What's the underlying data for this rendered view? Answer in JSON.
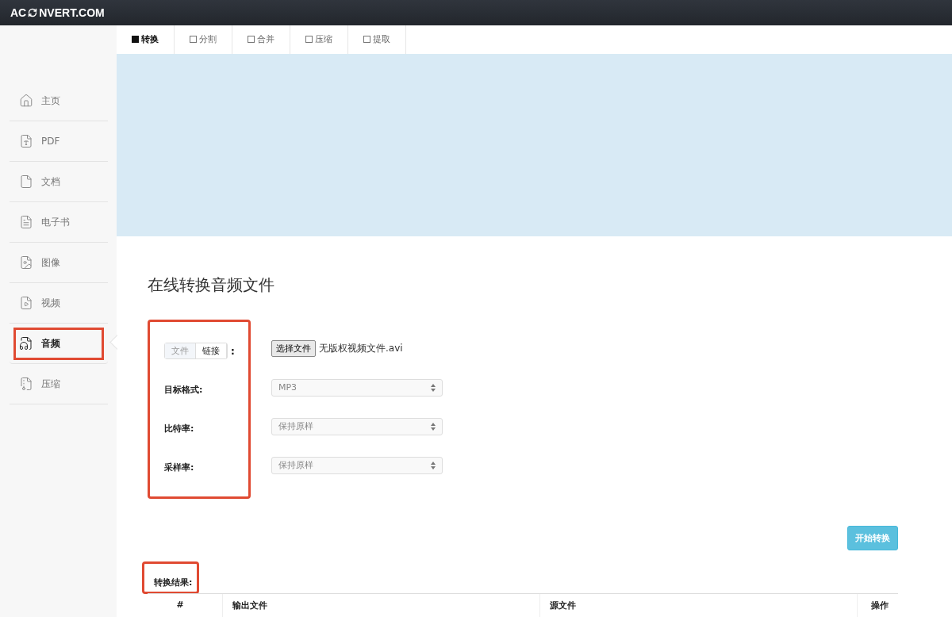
{
  "logo": {
    "before": "AC",
    "after": "NVERT.COM"
  },
  "sidebar": {
    "items": [
      {
        "label": "主页",
        "kind": "home",
        "selected": false,
        "annotated": false
      },
      {
        "label": "PDF",
        "kind": "pdf",
        "selected": false,
        "annotated": false
      },
      {
        "label": "文档",
        "kind": "word",
        "selected": false,
        "annotated": false
      },
      {
        "label": "电子书",
        "kind": "text",
        "selected": false,
        "annotated": false
      },
      {
        "label": "图像",
        "kind": "image",
        "selected": false,
        "annotated": false
      },
      {
        "label": "视频",
        "kind": "video",
        "selected": false,
        "annotated": false
      },
      {
        "label": "音频",
        "kind": "audio",
        "selected": true,
        "annotated": true
      },
      {
        "label": "压缩",
        "kind": "archive",
        "selected": false,
        "annotated": false
      }
    ]
  },
  "tabs": [
    {
      "label": "转换",
      "selected": true
    },
    {
      "label": "分割",
      "selected": false
    },
    {
      "label": "合并",
      "selected": false
    },
    {
      "label": "压缩",
      "selected": false
    },
    {
      "label": "提取",
      "selected": false
    }
  ],
  "title": "在线转换音频文件",
  "form": {
    "annotated": true,
    "source_toggle": [
      {
        "label": "文件",
        "selected": true
      },
      {
        "label": "链接",
        "selected": false
      }
    ],
    "source_colon": ":",
    "file_button": "选择文件",
    "file_name": "无版权视频文件.avi",
    "fields": [
      {
        "label": "目标格式:",
        "value": "MP3"
      },
      {
        "label": "比特率:",
        "value": "保持原样"
      },
      {
        "label": "采样率:",
        "value": "保持原样"
      }
    ]
  },
  "start_button": "开始转换",
  "results": {
    "label": "转换结果:",
    "annotated": true,
    "columns": [
      "#",
      "输出文件",
      "源文件",
      "操作"
    ]
  }
}
